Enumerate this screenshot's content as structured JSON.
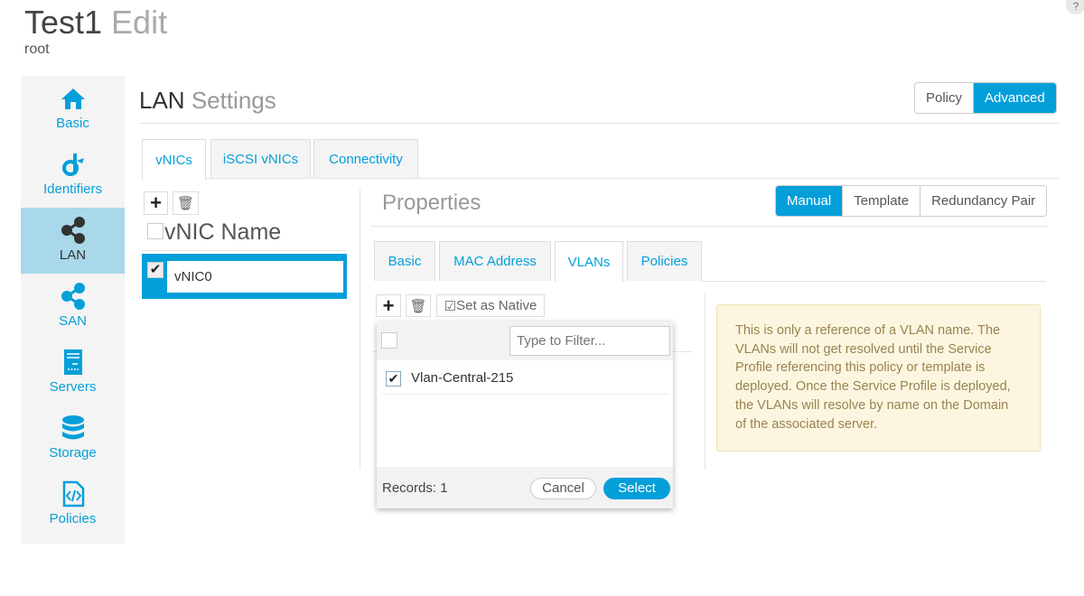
{
  "header": {
    "title": "Test1",
    "mode": "Edit",
    "org": "root",
    "help": "?"
  },
  "sidebar": {
    "items": [
      {
        "label": "Basic",
        "icon": "home-icon"
      },
      {
        "label": "Identifiers",
        "icon": "identifiers-icon"
      },
      {
        "label": "LAN",
        "icon": "share-icon",
        "active": true
      },
      {
        "label": "SAN",
        "icon": "share-icon"
      },
      {
        "label": "Servers",
        "icon": "server-icon"
      },
      {
        "label": "Storage",
        "icon": "database-icon"
      },
      {
        "label": "Policies",
        "icon": "code-file-icon"
      }
    ]
  },
  "section": {
    "title_a": "LAN",
    "title_b": "Settings",
    "modes": [
      "Policy",
      "Advanced"
    ],
    "active_mode": "Advanced"
  },
  "tabs": [
    {
      "label": "vNICs",
      "active": true
    },
    {
      "label": "iSCSI vNICs"
    },
    {
      "label": "Connectivity"
    }
  ],
  "vnics": {
    "column": "vNIC Name",
    "rows": [
      {
        "name": "vNIC0",
        "checked": true,
        "selected": true
      }
    ]
  },
  "properties": {
    "title": "Properties",
    "modes": [
      "Manual",
      "Template",
      "Redundancy Pair"
    ],
    "active_mode": "Manual",
    "tabs": [
      {
        "label": "Basic"
      },
      {
        "label": "MAC Address"
      },
      {
        "label": "VLANs",
        "active": true
      },
      {
        "label": "Policies"
      }
    ],
    "toolbar": {
      "set_native": "Set as Native"
    }
  },
  "vlan_popup": {
    "filter_placeholder": "Type to Filter...",
    "rows": [
      {
        "name": "Vlan-Central-215",
        "checked": true
      }
    ],
    "records": "Records: 1",
    "cancel": "Cancel",
    "select": "Select"
  },
  "info": "This is only a reference of a VLAN name. The VLANs will not get resolved until the Service Profile referencing this policy or template is deployed. Once the Service Profile is deployed, the VLANs will resolve by name on the Domain of the associated server.",
  "colors": {
    "accent": "#049fd9",
    "active_sidebar": "#a8d8ea",
    "info_bg": "#fcf6e1"
  }
}
